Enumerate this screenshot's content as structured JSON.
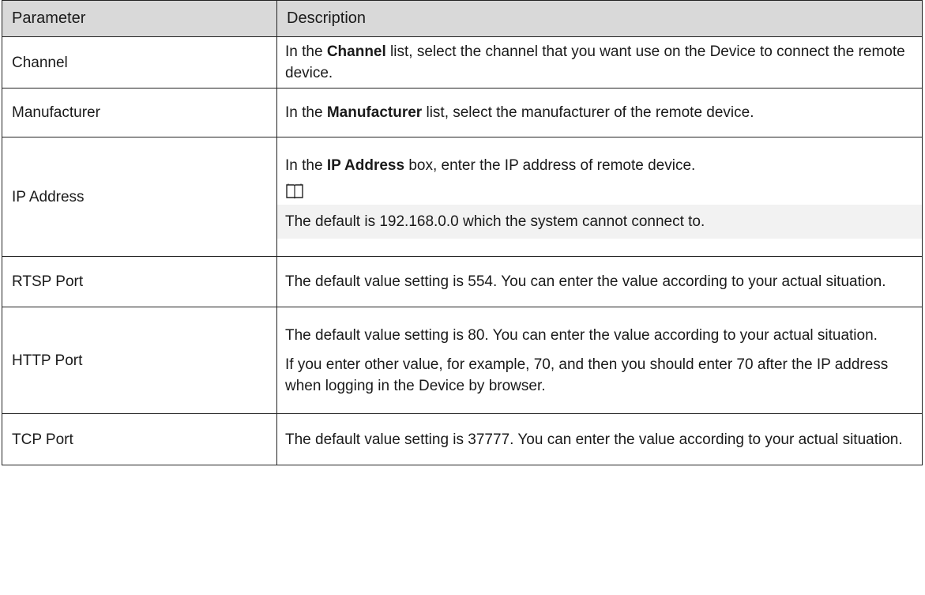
{
  "header": {
    "parameter": "Parameter",
    "description": "Description"
  },
  "rows": [
    {
      "param": "Channel",
      "desc_pre": "In the ",
      "desc_bold": "Channel",
      "desc_post": " list, select the channel that you want use on the Device to connect the remote device."
    },
    {
      "param": "Manufacturer",
      "desc_pre": "In the ",
      "desc_bold": "Manufacturer",
      "desc_post": " list, select the manufacturer of the remote device."
    },
    {
      "param": "IP Address",
      "desc_pre": "In the ",
      "desc_bold": "IP Address",
      "desc_post": " box, enter the IP address of remote device.",
      "note_icon": "book-note-icon",
      "note": "The default is 192.168.0.0 which the system cannot connect to."
    },
    {
      "param": "RTSP Port",
      "desc": "The default value setting is 554. You can enter the value according to your actual situation."
    },
    {
      "param": "HTTP Port",
      "desc": "The default value setting is 80. You can enter the value according to your actual situation.",
      "desc2": "If you enter other value, for example, 70, and then you should enter 70 after the IP address when logging in the Device by browser."
    },
    {
      "param": "TCP Port",
      "desc": "The default value setting is 37777. You can enter the value according to your actual situation."
    }
  ]
}
